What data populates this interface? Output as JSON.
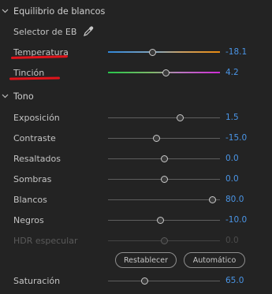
{
  "white_balance": {
    "title": "Equilibrio de blancos",
    "selector_label": "Selector de EB",
    "eyedropper_icon": "eyedropper-icon",
    "temperature": {
      "label": "Temperatura",
      "value": "-18.1",
      "fraction": 0.4
    },
    "tint": {
      "label": "Tinción",
      "value": "4.2",
      "fraction": 0.52
    }
  },
  "tone": {
    "title": "Tono",
    "exposure": {
      "label": "Exposición",
      "value": "1.5",
      "fraction": 0.65
    },
    "contrast": {
      "label": "Contraste",
      "value": "-15.0",
      "fraction": 0.44
    },
    "highlights": {
      "label": "Resaltados",
      "value": "0.0",
      "fraction": 0.51
    },
    "shadows": {
      "label": "Sombras",
      "value": "0.0",
      "fraction": 0.51
    },
    "whites": {
      "label": "Blancos",
      "value": "80.0",
      "fraction": 0.94
    },
    "blacks": {
      "label": "Negros",
      "value": "-10.0",
      "fraction": 0.47
    },
    "hdr_specular": {
      "label": "HDR especular",
      "value": "0.0",
      "fraction": 0.51,
      "disabled": true
    },
    "reset_label": "Restablecer",
    "auto_label": "Automático"
  },
  "saturation": {
    "label": "Saturación",
    "value": "65.0",
    "fraction": 0.33
  },
  "colors": {
    "value_blue": "#4a95e6",
    "annotation_red": "#e0141b"
  }
}
